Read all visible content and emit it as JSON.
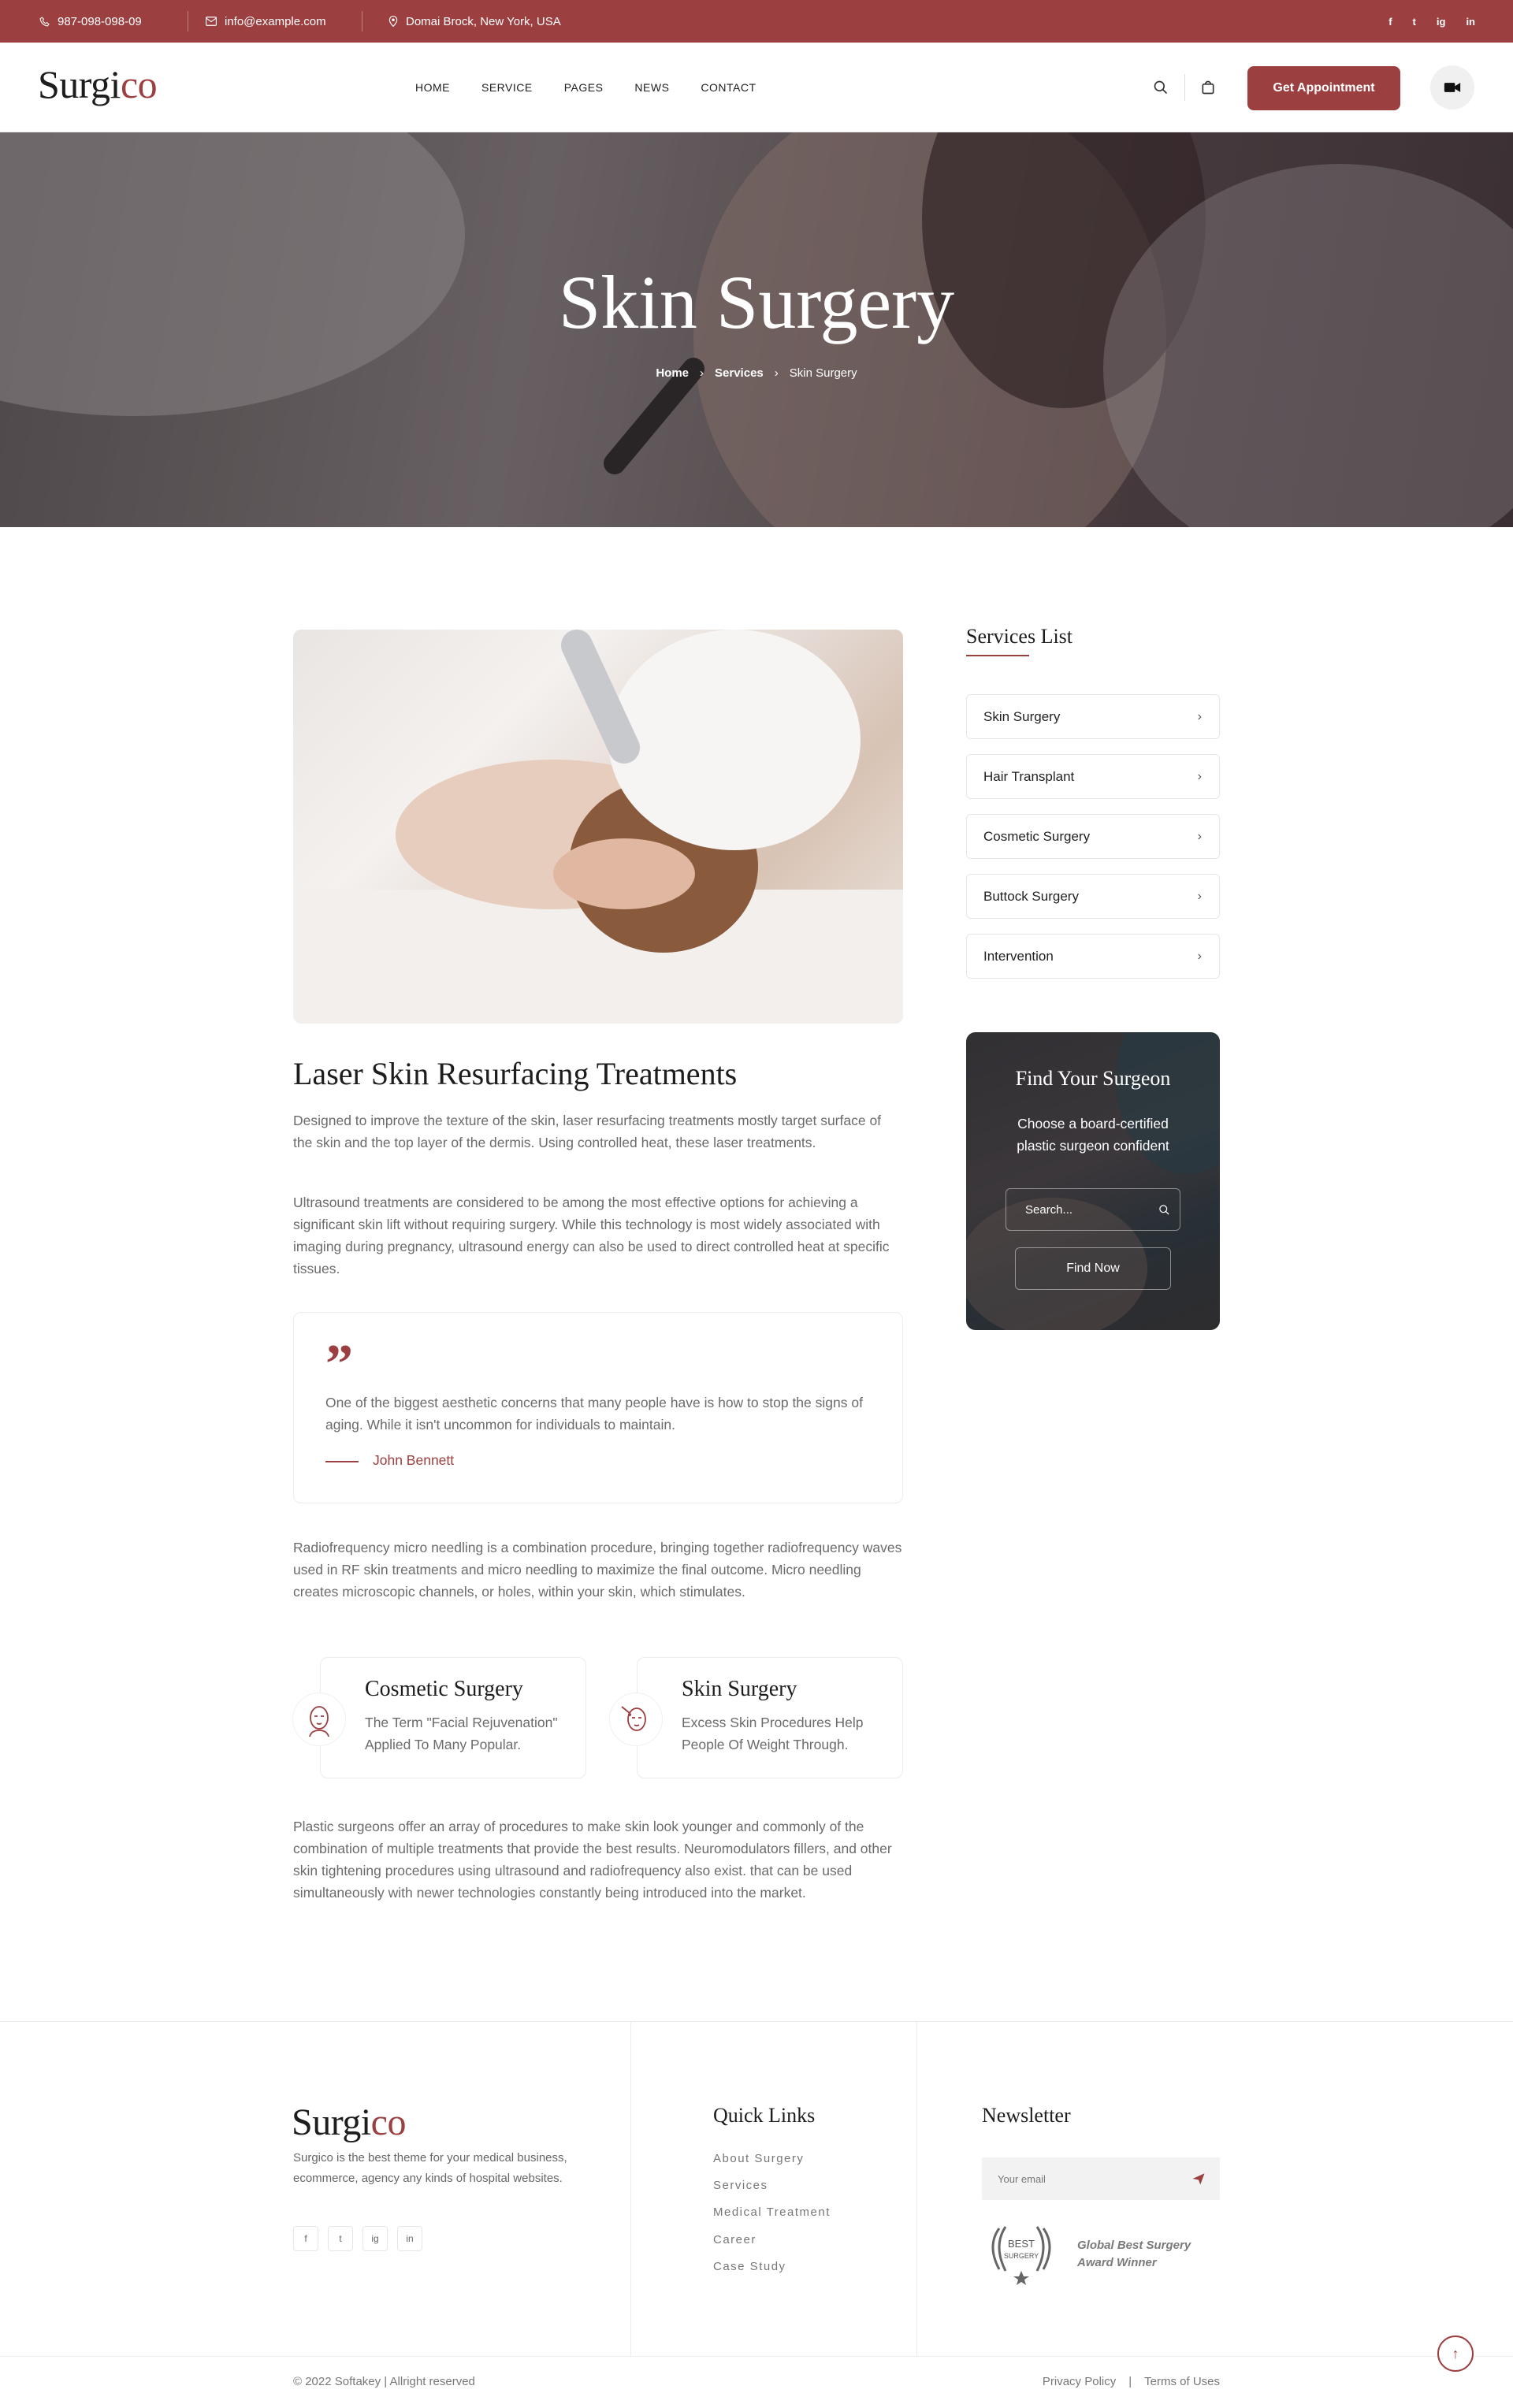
{
  "topbar": {
    "phone": "987-098-098-09",
    "email": "info@example.com",
    "address": "Domai Brock, New York, USA",
    "social": [
      "f",
      "t",
      "ig",
      "in"
    ]
  },
  "header": {
    "logo_main": "Surgi",
    "logo_accent": "co",
    "nav": [
      "HOME",
      "SERVICE",
      "PAGES",
      "NEWS",
      "CONTACT"
    ],
    "cta_label": "Get Appointment"
  },
  "hero": {
    "title": "Skin Surgery",
    "breadcrumb": [
      "Home",
      "Services",
      "Skin Surgery"
    ]
  },
  "main": {
    "title": "Laser Skin Resurfacing Treatments",
    "para1": "Designed to improve the texture of the skin, laser resurfacing treatments mostly target surface of the skin and the top layer of the dermis. Using controlled heat, these laser treatments.",
    "para2": "Ultrasound treatments are considered to be among the most effective options for achieving a significant skin lift without requiring surgery. While this technology is most widely associated with imaging during pregnancy, ultrasound energy can also be used to direct controlled heat at specific tissues.",
    "quote_text": "One of the biggest aesthetic concerns that many people have is how to stop the signs of aging. While it isn't uncommon for individuals to maintain.",
    "quote_author": "John Bennett",
    "para3": "Radiofrequency micro needling is a combination procedure, bringing together radiofrequency waves used in RF skin treatments and micro needling to maximize the final outcome. Micro needling creates microscopic channels, or holes, within your skin, which stimulates.",
    "features": [
      {
        "title": "Cosmetic Surgery",
        "text": "The Term \"Facial Rejuvenation\" Applied To Many Popular."
      },
      {
        "title": "Skin Surgery",
        "text": "Excess Skin Procedures Help People Of Weight Through."
      }
    ],
    "para4": "Plastic surgeons offer an array of procedures to make skin look younger and commonly of the combination of multiple treatments that provide the best results. Neuromodulators fillers, and other skin tightening procedures using ultrasound and radiofrequency also exist. that can be used simultaneously with newer technologies constantly being introduced into the market."
  },
  "sidebar": {
    "title": "Services List",
    "items": [
      "Skin Surgery",
      "Hair Transplant",
      "Cosmetic Surgery",
      "Buttock Surgery",
      "Intervention"
    ],
    "finder_title": "Find Your Surgeon",
    "finder_text": "Choose a board-certified plastic surgeon confident",
    "search_placeholder": "Search...",
    "find_label": "Find Now"
  },
  "footer": {
    "logo_main": "Surgi",
    "logo_accent": "co",
    "about": "Surgico is the best theme for your medical business, ecommerce, agency any kinds of hospital websites.",
    "social": [
      "f",
      "t",
      "ig",
      "in"
    ],
    "links_title": "Quick Links",
    "links": [
      "About Surgery",
      "Services",
      "Medical Treatment",
      "Career",
      "Case Study"
    ],
    "newsletter_title": "Newsletter",
    "email_placeholder": "Your email",
    "award_badge_top": "BEST",
    "award_badge_bottom": "SURGERY",
    "award_line1": "Global Best Surgery",
    "award_line2": "Award Winner",
    "copyright": "© 2022 Softakey | Allright reserved",
    "privacy": "Privacy Policy",
    "terms": "Terms of Uses"
  },
  "colors": {
    "brand": "#9b3f40",
    "heading": "#1d1d1d",
    "body_text": "#6b6b6b"
  }
}
